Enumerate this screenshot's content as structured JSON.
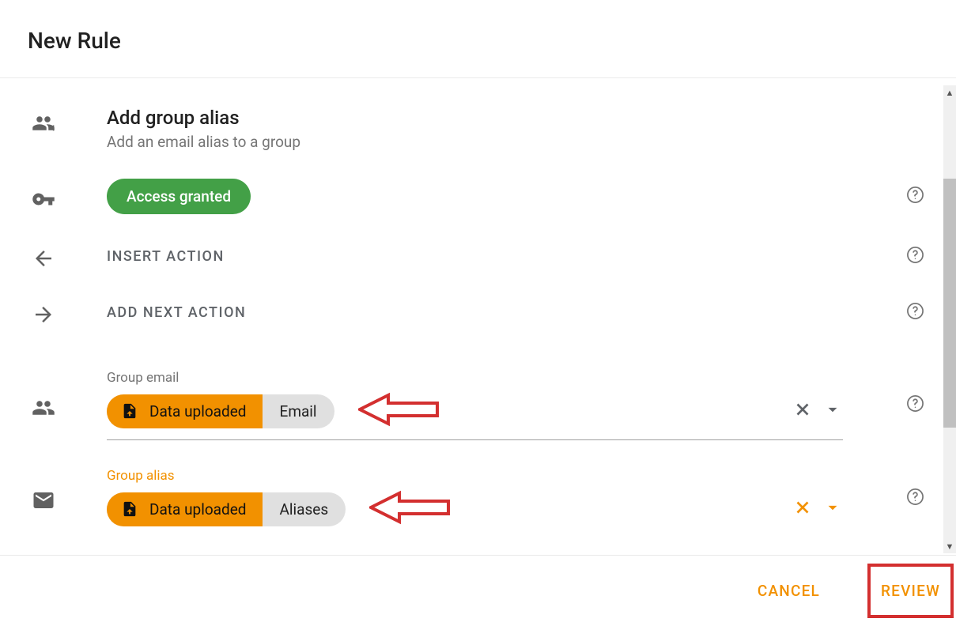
{
  "dialog": {
    "title": "New Rule"
  },
  "section1": {
    "title": "Add group alias",
    "subtitle": "Add an email alias to a group"
  },
  "access": {
    "badge": "Access granted"
  },
  "insert": {
    "label": "INSERT ACTION"
  },
  "addnext": {
    "label": "ADD NEXT ACTION"
  },
  "pill1": {
    "field_label": "Group email",
    "left": "Data uploaded",
    "right": "Email"
  },
  "pill2": {
    "field_label": "Group alias",
    "left": "Data uploaded",
    "right": "Aliases"
  },
  "footer": {
    "cancel": "CANCEL",
    "review": "REVIEW"
  }
}
